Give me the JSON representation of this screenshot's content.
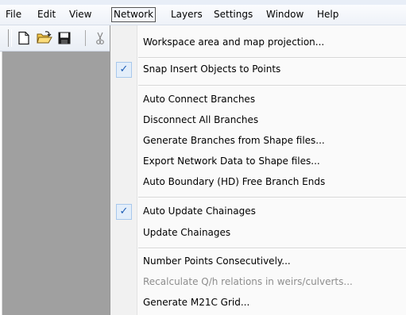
{
  "menubar": {
    "items": [
      {
        "label": "File"
      },
      {
        "label": "Edit"
      },
      {
        "label": "View"
      },
      {
        "label": "Network"
      },
      {
        "label": "Layers"
      },
      {
        "label": "Settings"
      },
      {
        "label": "Window"
      },
      {
        "label": "Help"
      }
    ]
  },
  "toolbar": {
    "icons": [
      "new-document-icon",
      "open-folder-icon",
      "save-disk-icon",
      "cut-scissors-icon"
    ]
  },
  "network_menu": {
    "items": [
      {
        "label": "Workspace area and map projection...",
        "checked": false,
        "enabled": true
      },
      {
        "label": "Snap Insert Objects to Points",
        "checked": true,
        "enabled": true
      },
      {
        "label": "Auto Connect Branches",
        "checked": false,
        "enabled": true
      },
      {
        "label": "Disconnect All Branches",
        "checked": false,
        "enabled": true
      },
      {
        "label": "Generate Branches from Shape files...",
        "checked": false,
        "enabled": true
      },
      {
        "label": "Export Network Data to Shape files...",
        "checked": false,
        "enabled": true
      },
      {
        "label": "Auto Boundary (HD) Free Branch Ends",
        "checked": false,
        "enabled": true
      },
      {
        "label": "Auto Update Chainages",
        "checked": true,
        "enabled": true
      },
      {
        "label": "Update Chainages",
        "checked": false,
        "enabled": true
      },
      {
        "label": "Number Points Consecutively...",
        "checked": false,
        "enabled": true
      },
      {
        "label": "Recalculate Q/h relations in weirs/culverts...",
        "checked": false,
        "enabled": false
      },
      {
        "label": "Generate M21C Grid...",
        "checked": false,
        "enabled": true
      }
    ],
    "check_glyph": "✓"
  },
  "colors": {
    "check_color": "#1d5db5",
    "panel_gray": "#a0a0a0",
    "disabled_text": "#8d8d8d"
  }
}
